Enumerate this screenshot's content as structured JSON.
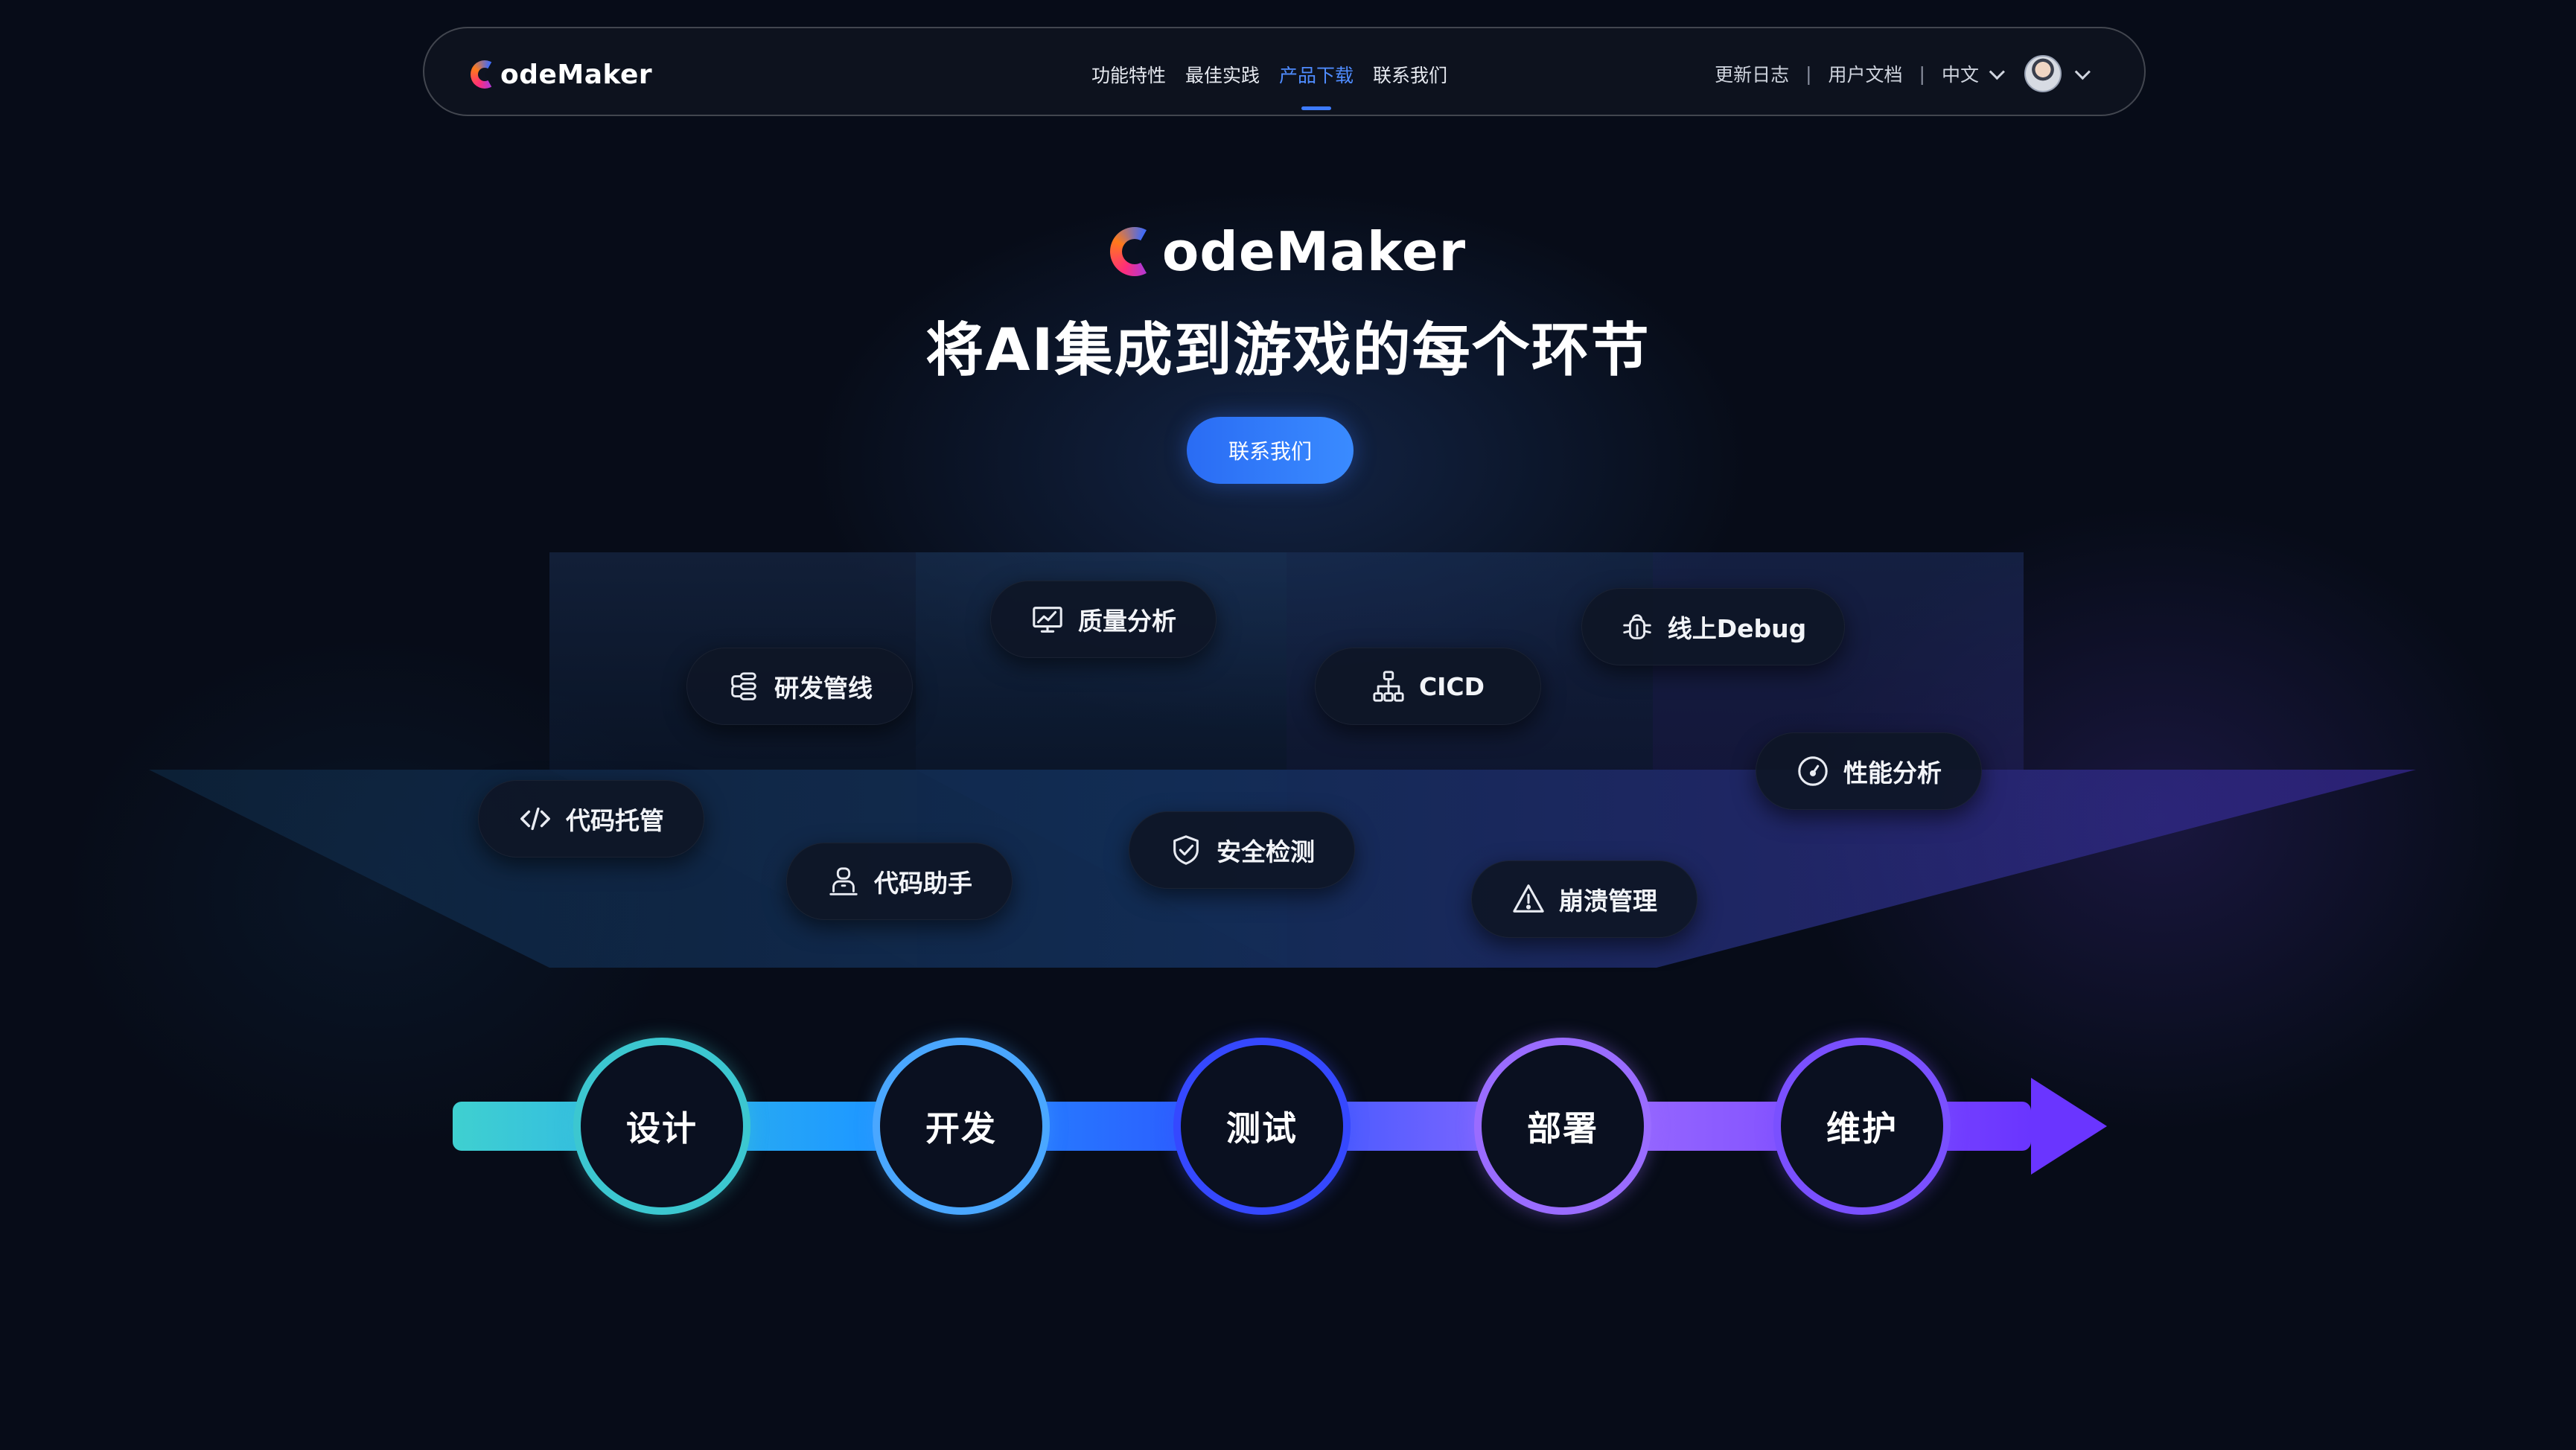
{
  "nav": {
    "logo_mark": "C",
    "logo_text": "odeMaker",
    "links": [
      {
        "label": "功能特性"
      },
      {
        "label": "最佳实践"
      },
      {
        "label": "产品下载"
      },
      {
        "label": "联系我们"
      }
    ],
    "right": {
      "changelog": "更新日志",
      "separator": "|",
      "docs": "用户文档",
      "language": "中文"
    }
  },
  "hero": {
    "logo_mark": "C",
    "logo_text": "odeMaker",
    "title": "将AI集成到游戏的每个环节",
    "cta_label": "联系我们"
  },
  "features": [
    {
      "label": "质量分析",
      "icon": "monitor-chart-icon"
    },
    {
      "label": "研发管线",
      "icon": "pipeline-icon"
    },
    {
      "label": "CICD",
      "icon": "hierarchy-icon"
    },
    {
      "label": "线上Debug",
      "icon": "bug-icon"
    },
    {
      "label": "性能分析",
      "icon": "gauge-icon"
    },
    {
      "label": "代码托管",
      "icon": "code-icon"
    },
    {
      "label": "代码助手",
      "icon": "assistant-icon"
    },
    {
      "label": "安全检测",
      "icon": "shield-check-icon"
    },
    {
      "label": "崩溃管理",
      "icon": "warning-icon"
    }
  ],
  "stages": [
    {
      "label": "设计"
    },
    {
      "label": "开发"
    },
    {
      "label": "测试"
    },
    {
      "label": "部署"
    },
    {
      "label": "维护"
    }
  ],
  "colors": {
    "background": "#070c18",
    "accent": "#3d7bff",
    "pill_bg": "#0e1626",
    "stage_gradient": [
      "#36c8d2",
      "#1f8fff",
      "#2d5bff",
      "#8b5cf6",
      "#6a3bff"
    ]
  }
}
